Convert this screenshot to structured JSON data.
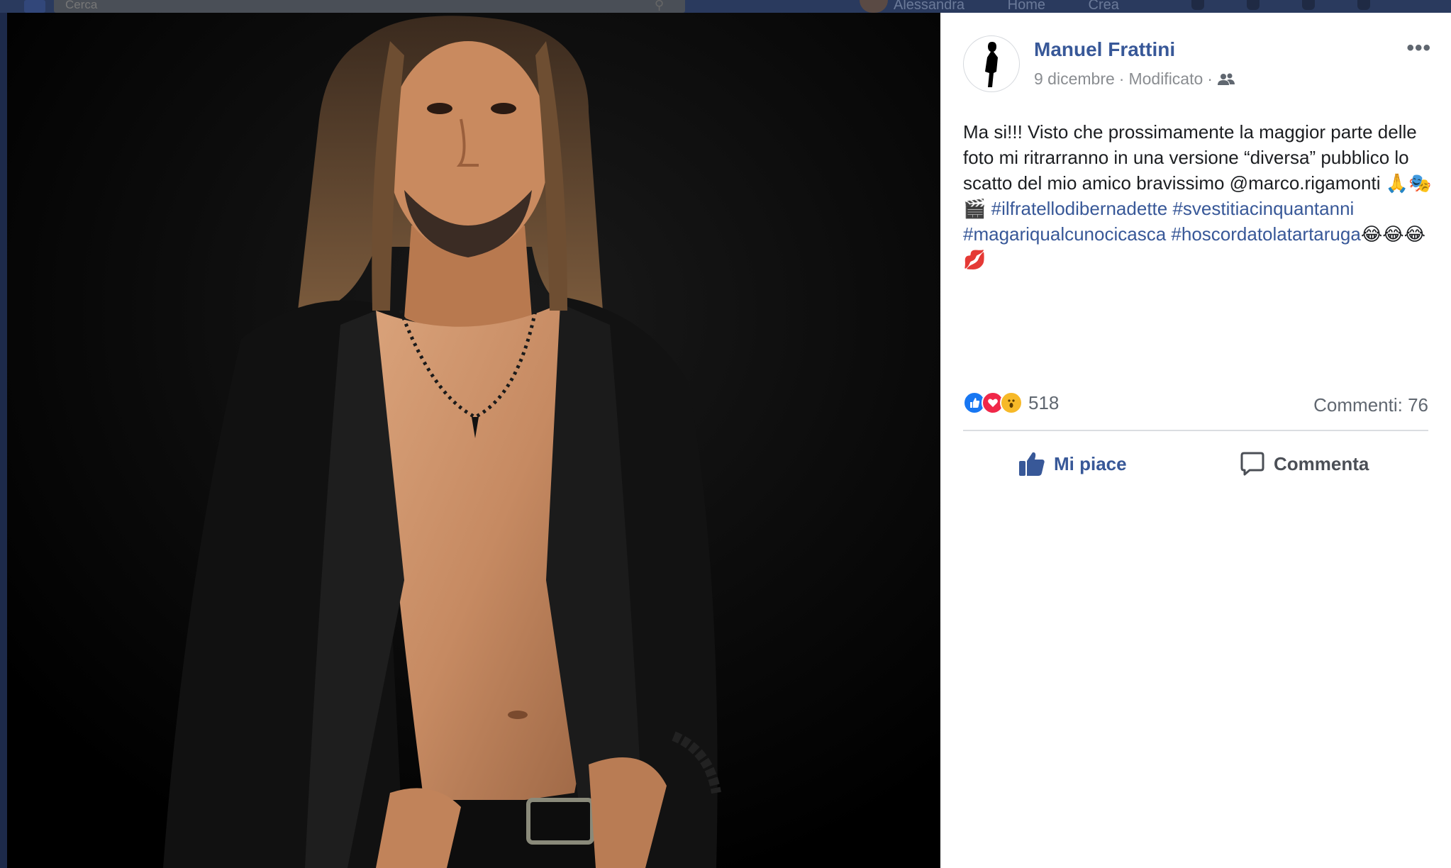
{
  "background": {
    "search_placeholder": "Cerca",
    "nav_items": [
      "Alessandra",
      "Home",
      "Crea"
    ]
  },
  "post": {
    "author": "Manuel Frattini",
    "date": "9 dicembre",
    "edited": "Modificato",
    "separator": "·",
    "audience_icon": "friends-icon",
    "text_plain": "Ma si!!! Visto che prossimamente la maggior parte delle foto mi ritrarranno in una versione “diversa” pubblico lo scatto del mio amico bravissimo @marco.rigamonti 🙏🎭🎬",
    "hashtags": [
      "#ilfratellodibernadette",
      "#svestitiacinquantanni",
      "#magariqualcunocicasca",
      "#hoscordatolatartaruga"
    ],
    "emoji_tail": "😂😂😂💋",
    "reaction_count": "518",
    "comments_label": "Commenti: 76",
    "like_label": "Mi piace",
    "comment_label": "Commenta"
  },
  "colors": {
    "link_blue": "#385898",
    "like_blue": "#1877f2",
    "love_red": "#f02849",
    "wow_yellow": "#f7b928",
    "muted_gray": "#606770"
  }
}
